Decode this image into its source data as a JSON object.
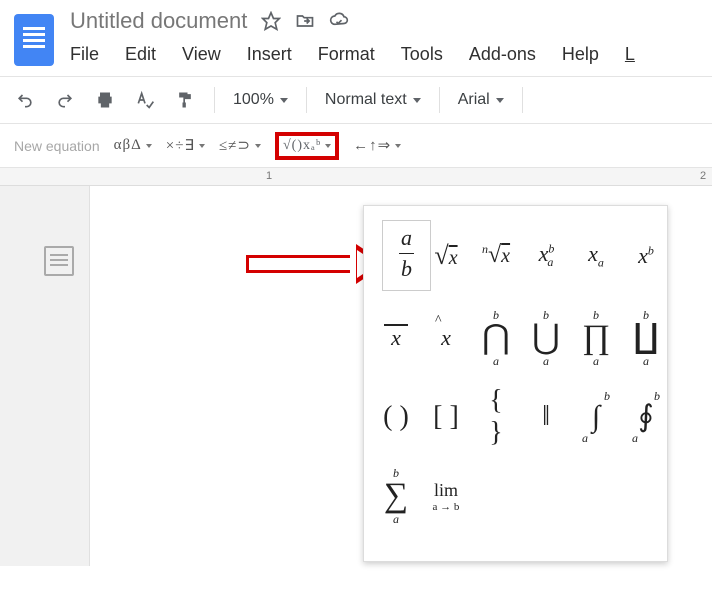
{
  "header": {
    "title": "Untitled document"
  },
  "menu": {
    "file": "File",
    "edit": "Edit",
    "view": "View",
    "insert": "Insert",
    "format": "Format",
    "tools": "Tools",
    "addons": "Add-ons",
    "help": "Help",
    "last": "L"
  },
  "toolbar": {
    "zoom": "100%",
    "style": "Normal text",
    "font": "Arial"
  },
  "eqbar": {
    "new_equation": "New equation",
    "greek": "αβΔ",
    "ops": "×÷∃",
    "rel": "≤≠⊃",
    "math": "√()xₐᵇ",
    "arrows": "←↑⇒"
  },
  "ruler": {
    "m1": "1",
    "m2": "2"
  },
  "panel": {
    "r1": {
      "frac_num": "a",
      "frac_den": "b",
      "sqrt": "√x",
      "nroot": "ⁿ√x",
      "xab": "x",
      "xa": "x",
      "xb": "x"
    },
    "r2": {
      "xbar": "x",
      "xhat": "x",
      "cap": "⋂",
      "cup": "⋃",
      "prod": "∏",
      "coprod": "∐"
    },
    "r3": {
      "paren": "( )",
      "brack": "[ ]",
      "brace": "{ }",
      "vert": "‖",
      "int": "∫",
      "oint": "∮"
    },
    "r4": {
      "sum": "∑",
      "lim": "lim",
      "lim_sub": "a → b"
    },
    "bnd_a": "a",
    "bnd_b": "b"
  }
}
